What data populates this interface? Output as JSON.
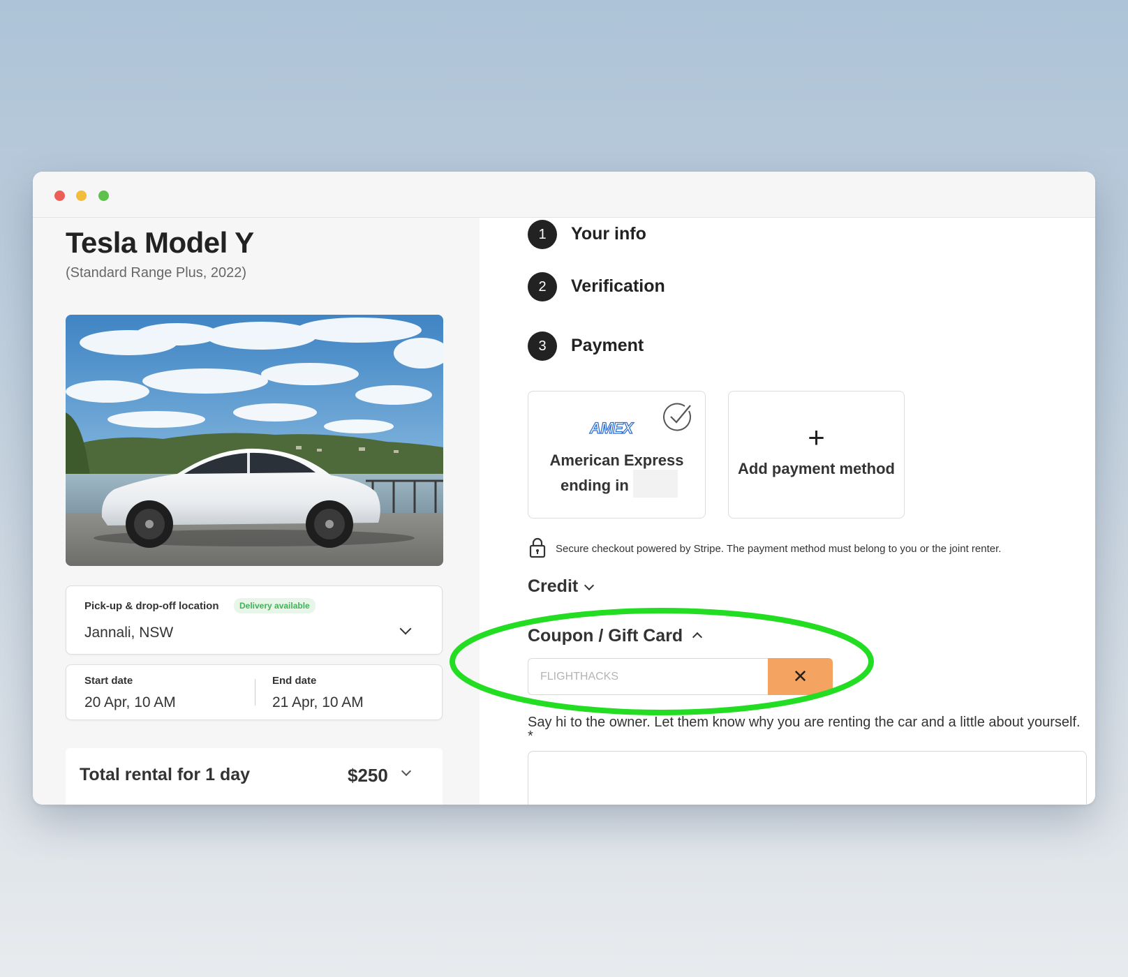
{
  "car": {
    "title": "Tesla Model Y",
    "subtitle": "(Standard Range Plus, 2022)"
  },
  "location": {
    "label": "Pick-up & drop-off location",
    "badge": "Delivery available",
    "value": "Jannali, NSW"
  },
  "dates": {
    "start_label": "Start date",
    "start_value": "20 Apr, 10 AM",
    "end_label": "End date",
    "end_value": "21 Apr, 10 AM"
  },
  "total": {
    "label": "Total rental for 1 day",
    "price": "$250"
  },
  "steps": [
    {
      "number": "1",
      "label": "Your info"
    },
    {
      "number": "2",
      "label": "Verification"
    },
    {
      "number": "3",
      "label": "Payment"
    }
  ],
  "payment": {
    "amex_logo": "AMEX",
    "amex_line1": "American Express",
    "amex_line2": "ending in",
    "add_symbol": "+",
    "add_label": "Add payment method",
    "secure_text": "Secure checkout powered by Stripe. The payment method must belong to you or the joint renter."
  },
  "credit": {
    "label": "Credit"
  },
  "coupon": {
    "label": "Coupon / Gift Card",
    "placeholder": "FLIGHTHACKS",
    "clear_symbol": "✕"
  },
  "owner_message": {
    "prompt": "Say hi to the owner. Let them know why you are renting the car and a little about yourself. *"
  },
  "colors": {
    "accent_orange": "#f4a460",
    "highlight_green": "#22dd22",
    "badge_green": "#43b157",
    "amex_blue": "#2f6fd1"
  },
  "icons": [
    "close-window-dot",
    "minimize-window-dot",
    "zoom-window-dot",
    "chevron-down-icon",
    "check-circle-icon",
    "plus-icon",
    "lock-icon",
    "chevron-up-icon",
    "close-icon"
  ]
}
